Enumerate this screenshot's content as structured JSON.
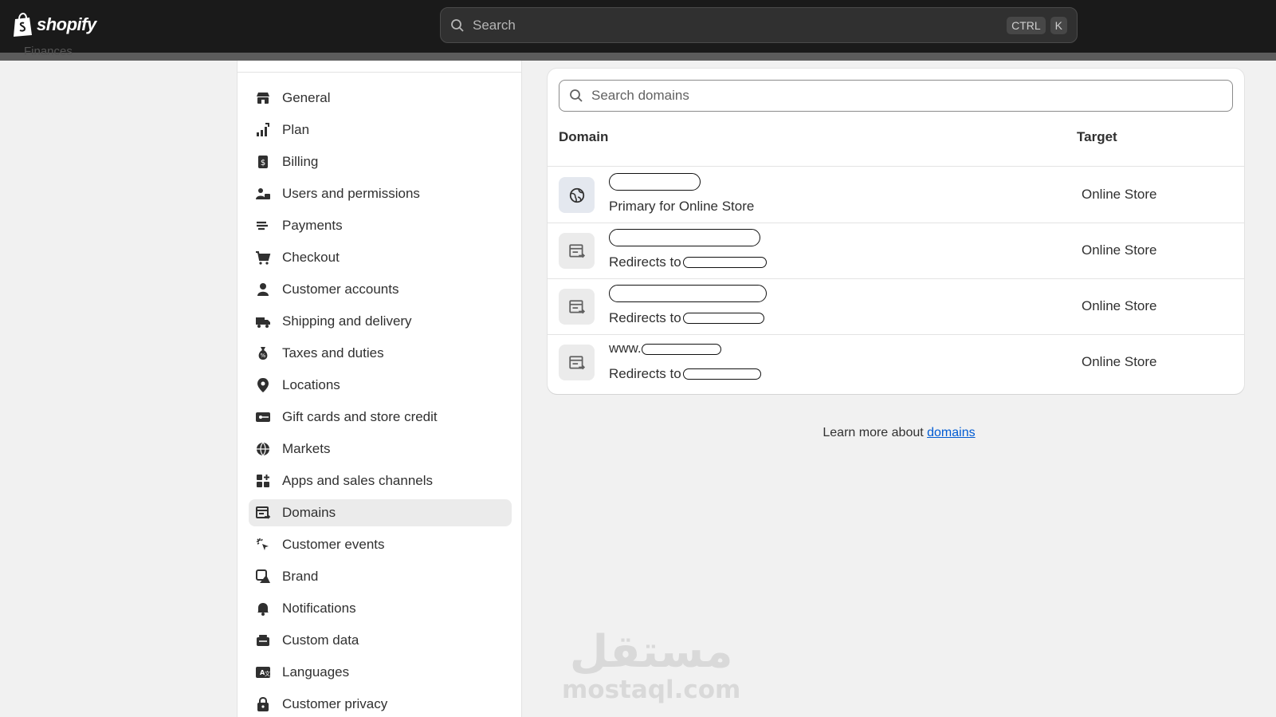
{
  "topbar": {
    "brand": "shopify",
    "search_placeholder": "Search",
    "shortcut_keys": [
      "CTRL",
      "K"
    ]
  },
  "sidebar_partial_label": "Finances",
  "settings_nav": {
    "items": [
      {
        "label": "General",
        "icon": "store-icon"
      },
      {
        "label": "Plan",
        "icon": "plan-icon"
      },
      {
        "label": "Billing",
        "icon": "billing-icon"
      },
      {
        "label": "Users and permissions",
        "icon": "users-icon"
      },
      {
        "label": "Payments",
        "icon": "payments-icon"
      },
      {
        "label": "Checkout",
        "icon": "cart-icon"
      },
      {
        "label": "Customer accounts",
        "icon": "person-icon"
      },
      {
        "label": "Shipping and delivery",
        "icon": "truck-icon"
      },
      {
        "label": "Taxes and duties",
        "icon": "tax-bag-icon"
      },
      {
        "label": "Locations",
        "icon": "location-pin-icon"
      },
      {
        "label": "Gift cards and store credit",
        "icon": "gift-card-icon"
      },
      {
        "label": "Markets",
        "icon": "globe-icon"
      },
      {
        "label": "Apps and sales channels",
        "icon": "apps-icon"
      },
      {
        "label": "Domains",
        "icon": "domain-icon",
        "active": true
      },
      {
        "label": "Customer events",
        "icon": "cursor-click-icon"
      },
      {
        "label": "Brand",
        "icon": "brand-icon"
      },
      {
        "label": "Notifications",
        "icon": "bell-icon"
      },
      {
        "label": "Custom data",
        "icon": "database-icon"
      },
      {
        "label": "Languages",
        "icon": "language-icon"
      },
      {
        "label": "Customer privacy",
        "icon": "lock-icon"
      }
    ]
  },
  "domains": {
    "search_placeholder": "Search domains",
    "columns": {
      "domain": "Domain",
      "target": "Target"
    },
    "rows": [
      {
        "name_visible": "",
        "subtitle": "Primary for Online Store",
        "target": "Online Store",
        "icon": "globe-icon"
      },
      {
        "name_visible": "",
        "subtitle": "Redirects to",
        "target": "Online Store",
        "icon": "redirect-icon"
      },
      {
        "name_visible": "",
        "subtitle": "Redirects to",
        "target": "Online Store",
        "icon": "redirect-icon"
      },
      {
        "name_visible": "www.",
        "subtitle": "Redirects to",
        "target": "Online Store",
        "icon": "redirect-icon"
      }
    ]
  },
  "footer": {
    "learn_prefix": "Learn more about ",
    "learn_link": "domains"
  },
  "watermark": {
    "arabic": "مستقل",
    "latin": "mostaql.com"
  },
  "colors": {
    "topbar": "#1a1a1a",
    "link": "#005bd3",
    "active_nav": "#ebebeb"
  }
}
